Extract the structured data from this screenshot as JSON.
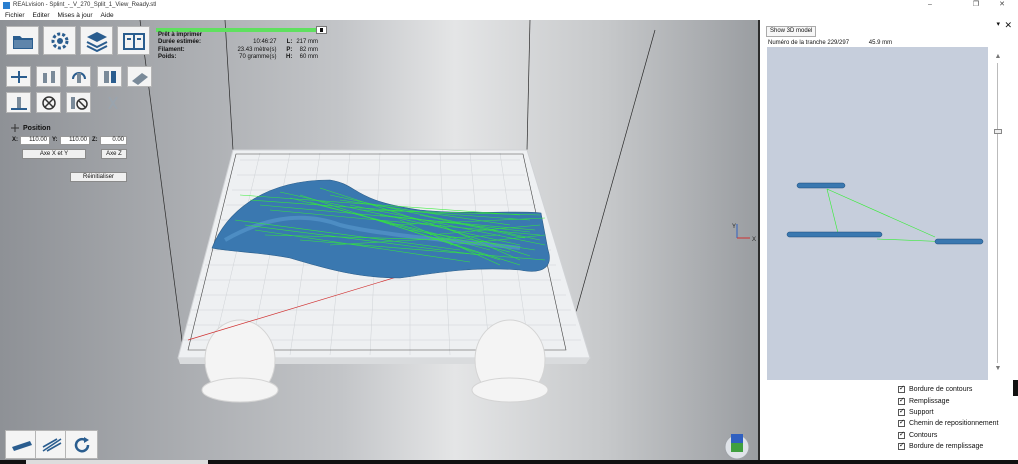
{
  "window": {
    "title": "REALvision - Splint_-_V_270_Split_1_View_Ready.stl",
    "controls": [
      "–",
      "❐",
      "✕"
    ]
  },
  "menu": [
    "Fichier",
    "Editer",
    "Mises à jour",
    "Aide"
  ],
  "print_info": {
    "progress": 0.94,
    "status": "Prêt à imprimer",
    "rows": [
      {
        "label": "Durée estimée:",
        "value": "10:46:27",
        "key": "L:",
        "value2": "217 mm"
      },
      {
        "label": "Filament:",
        "value": "23.43 mètre(s)",
        "key": "P:",
        "value2": "82 mm"
      },
      {
        "label": "Poids:",
        "value": "70 gramme(s)",
        "key": "H:",
        "value2": "60 mm"
      }
    ]
  },
  "toolbar": {
    "top_icons": [
      "folder-icon",
      "gear-icon",
      "layers-icon",
      "info-panel-icon"
    ],
    "row2_icons": [
      "move-icon",
      "scale-icon",
      "rotate-icon",
      "mirror-icon",
      "place-flat-icon"
    ],
    "row3_icons": [
      "support-add-icon",
      "support-remove-icon",
      "support-remove-all-icon",
      "cut-icon"
    ],
    "bottom_icons": [
      "slice-icon",
      "preview-icon",
      "refresh-icon"
    ]
  },
  "position": {
    "title": "Position",
    "x_label": "X:",
    "x_value": "110.00",
    "y_label": "Y:",
    "y_value": "110.00",
    "z_label": "Z:",
    "z_value": "0.00",
    "axis_xy_button": "Axe X et Y",
    "axis_z_button": "Axe Z",
    "reset_button": "Réinitialiser"
  },
  "axes_gizmo": {
    "x": "X",
    "y": "Y"
  },
  "right_panel": {
    "show3d_button": "Show 3D model",
    "slice_label": "Numéro de la tranche 229/297",
    "slice_height": "45.9 mm",
    "checkboxes": [
      {
        "label": "Bordure de contours",
        "checked": true
      },
      {
        "label": "Remplissage",
        "checked": true
      },
      {
        "label": "Support",
        "checked": true
      },
      {
        "label": "Chemin de repositionnement",
        "checked": true
      },
      {
        "label": "Contours",
        "checked": true
      },
      {
        "label": "Bordure de remplissage",
        "checked": true
      }
    ]
  },
  "colors": {
    "model_blue": "#3a78b0",
    "travel_green": "#33ee33",
    "slice_bg": "#c6cedc"
  }
}
